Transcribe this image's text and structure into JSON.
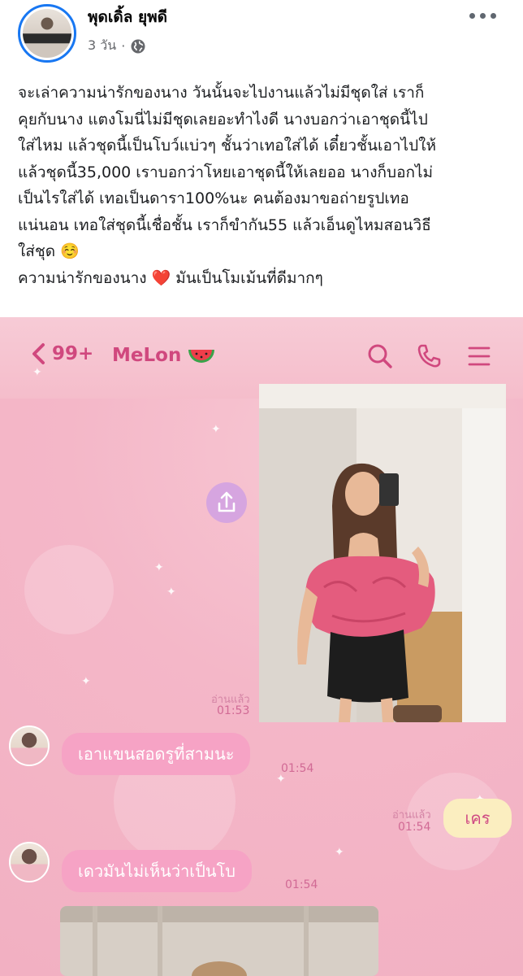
{
  "post": {
    "author": "พุดเดิ้ล ยุพดี",
    "time": "3 วัน",
    "separator": "·",
    "privacy_icon": "globe-icon",
    "more_icon": "more-horizontal-icon",
    "text_lines": [
      "จะเล่าความน่ารักของนาง วันนั้นจะไปงานแล้วไม่มีชุดใส่ เราก็",
      "คุยกับนาง แตงโมนี่ไม่มีชุดเลยอะทำไงดี นางบอกว่าเอาชุดนี้ไป",
      "ใส่ไหม แล้วชุดนี้เป็นโบว์แบ่วๆ ชั้นว่าเทอใส่ได้ เดี๋ยวชั้นเอาไปให้",
      "แล้วชุดนี้35,000  เราบอกว่าโหยเอาชุดนี้ให้เลยออ นางก็บอกไม่",
      "เป็นไรใส่ได้ เทอเป็นดารา100%นะ คนต้องมาขอถ่ายรูปเทอ",
      "แน่นอน เทอใส่ชุดนี้เชื่อชั้น เราก็ขำกัน55 แล้วเอ็นดูไหมสอนวิธี",
      "ใส่ชุด ☺️",
      "ความน่ารักของนาง ❤️ มันเป็นโมเม้นที่ดีมากๆ"
    ]
  },
  "chat": {
    "unread_count": "99+",
    "contact_name": "MeLon",
    "contact_emoji": "watermelon-icon",
    "header_icons": [
      "search-icon",
      "phone-icon",
      "menu-icon"
    ],
    "messages": [
      {
        "type": "photo",
        "read": "อ่านแล้ว",
        "time": "01:53"
      },
      {
        "type": "text",
        "from": "contact",
        "text": "เอาแขนสอดรูที่สามนะ",
        "time": "01:54"
      },
      {
        "type": "text",
        "from": "me",
        "text": "เคร",
        "read": "อ่านแล้ว",
        "time": "01:54"
      },
      {
        "type": "text",
        "from": "contact",
        "text": "เดวมันไม่เห็นว่าเป็นโบ",
        "time": "01:54"
      }
    ]
  },
  "colors": {
    "accent_blue": "#1877f2",
    "line_pink": "#d0487e",
    "bubble_pink": "#f6a3c5",
    "bubble_yellow": "#fbeec0"
  }
}
